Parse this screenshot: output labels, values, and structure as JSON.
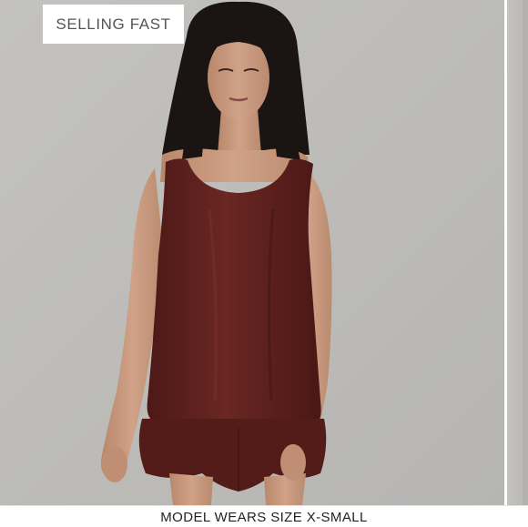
{
  "badge": {
    "label": "SELLING FAST"
  },
  "caption": {
    "text": "MODEL WEARS SIZE X-SMALL"
  },
  "colors": {
    "backdrop": "#bdbcb9",
    "garment": "#5a1f1c",
    "hair": "#1a1412",
    "skin": "#c99a7e",
    "badge_text": "#555555",
    "caption_text": "#222222"
  }
}
